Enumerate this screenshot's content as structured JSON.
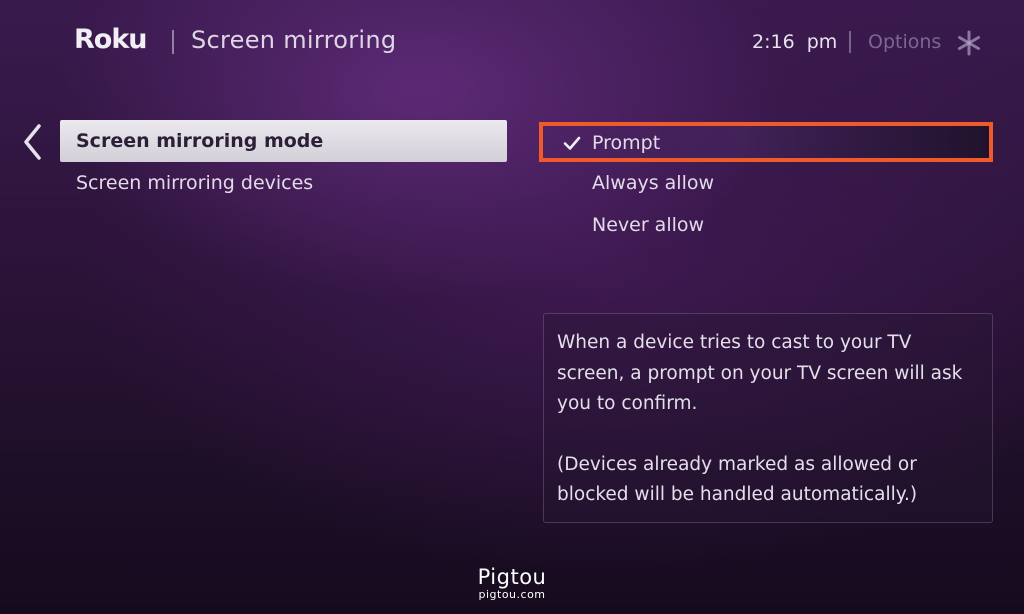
{
  "header": {
    "logo_text": "Roku",
    "title": "Screen mirroring",
    "time": "2:16  pm",
    "options_label": "Options",
    "options_icon": "asterisk-icon"
  },
  "nav": {
    "back_icon": "chevron-left-icon"
  },
  "menu": {
    "items": [
      {
        "label": "Screen mirroring mode",
        "selected": true
      },
      {
        "label": "Screen mirroring devices",
        "selected": false
      }
    ]
  },
  "mode_options": {
    "items": [
      {
        "label": "Prompt",
        "checked": true
      },
      {
        "label": "Always allow",
        "checked": false
      },
      {
        "label": "Never allow",
        "checked": false
      }
    ],
    "check_icon": "checkmark-icon"
  },
  "description": {
    "paragraph1": "When a device tries to cast to your TV screen, a prompt on your TV screen will ask you to confirm.",
    "paragraph2": "(Devices already marked as allowed or blocked will be handled automatically.)"
  },
  "watermark": {
    "brand": "Pigtou",
    "url": "pigtou.com"
  },
  "colors": {
    "background": "#2b1338",
    "highlight_frame": "#f05a2a",
    "selected_item_bg": "#e2dfe6",
    "text": "#e2dce8"
  }
}
